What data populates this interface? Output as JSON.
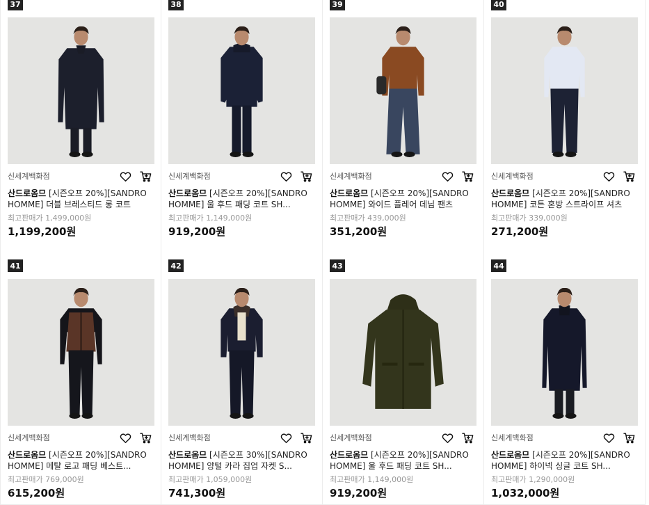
{
  "products": [
    {
      "rank": "37",
      "store": "신세계백화점",
      "brand": "산드로옴므",
      "name": "[시즌오프 20%][SANDRO HOMME] 더블 브레스티드 롱 코트",
      "orig_label": "최고판매가 1,499,000원",
      "price": "1,199,200원",
      "garment": "long-coat"
    },
    {
      "rank": "38",
      "store": "신세계백화점",
      "brand": "산드로옴므",
      "name": "[시즌오프 20%][SANDRO HOMME] 울 후드 패딩 코트 SH...",
      "orig_label": "최고판매가 1,149,000원",
      "price": "919,200원",
      "garment": "hood-coat"
    },
    {
      "rank": "39",
      "store": "신세계백화점",
      "brand": "산드로옴므",
      "name": "[시즌오프 20%][SANDRO HOMME] 와이드 플레어 데님 팬츠",
      "orig_label": "최고판매가 439,000원",
      "price": "351,200원",
      "garment": "sweater-denim"
    },
    {
      "rank": "40",
      "store": "신세계백화점",
      "brand": "산드로옴므",
      "name": "[시즌오프 20%][SANDRO HOMME] 코튼 혼방 스트라이프 셔츠",
      "orig_label": "최고판매가 339,000원",
      "price": "271,200원",
      "garment": "shirt"
    },
    {
      "rank": "41",
      "store": "신세계백화점",
      "brand": "산드로옴므",
      "name": "[시즌오프 20%][SANDRO HOMME] 메탈 로고 패딩 베스트...",
      "orig_label": "최고판매가 769,000원",
      "price": "615,200원",
      "garment": "vest"
    },
    {
      "rank": "42",
      "store": "신세계백화점",
      "brand": "산드로옴므",
      "name": "[시즌오프 30%][SANDRO HOMME] 양털 카라 집업 자켓 S...",
      "orig_label": "최고판매가 1,059,000원",
      "price": "741,300원",
      "garment": "jacket"
    },
    {
      "rank": "43",
      "store": "신세계백화점",
      "brand": "산드로옴므",
      "name": "[시즌오프 20%][SANDRO HOMME] 울 후드 패딩 코트 SH...",
      "orig_label": "최고판매가 1,149,000원",
      "price": "919,200원",
      "garment": "parka"
    },
    {
      "rank": "44",
      "store": "신세계백화점",
      "brand": "산드로옴므",
      "name": "[시즌오프 20%][SANDRO HOMME] 하이넥 싱글 코트 SH...",
      "orig_label": "최고판매가 1,290,000원",
      "price": "1,032,000원",
      "garment": "single-coat"
    }
  ],
  "icons": {
    "wish": "heart-icon",
    "cart": "cart-icon"
  },
  "colors": {
    "rank_bg": "#222222",
    "photo_bg": "#e4e4e2",
    "divider": "#ececec"
  }
}
